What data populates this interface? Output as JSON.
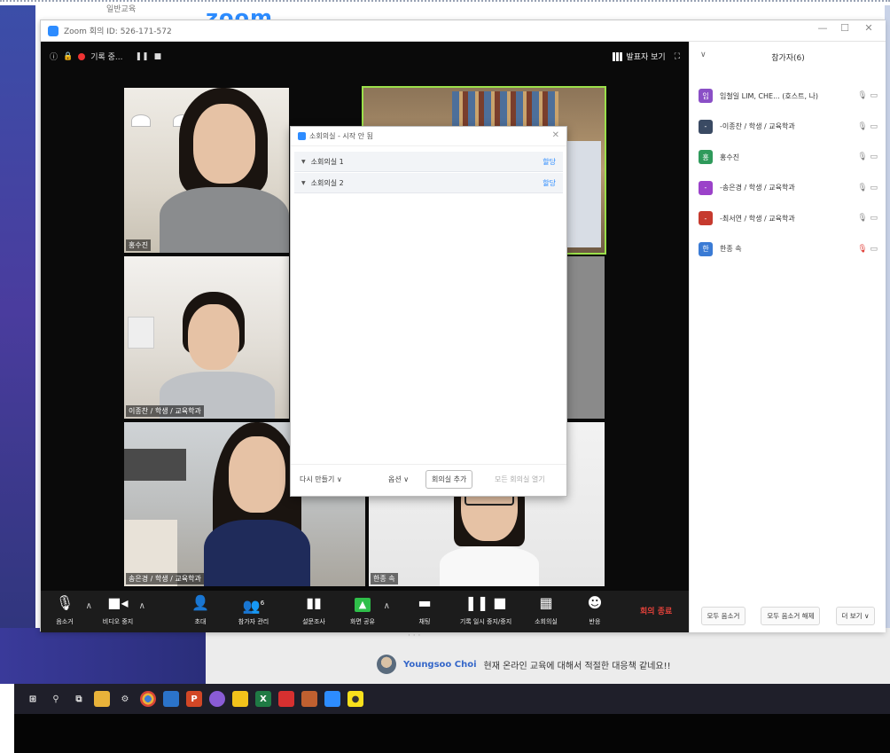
{
  "background": {
    "zoom_logo": "zoom",
    "title_left": "일반교육",
    "chat": {
      "name": "Youngsoo Choi",
      "message": "현재 온라인 교육에 대해서 적절한 대응책 같네요!!"
    }
  },
  "window": {
    "title": "Zoom 회의 ID: 526-171-572",
    "min": "—",
    "max": "☐",
    "close": "✕"
  },
  "video_top": {
    "status": "기록 중...",
    "gallery_view": "발표자 보기",
    "fullscreen": "⛶"
  },
  "tiles": [
    {
      "label": "홍수진"
    },
    {
      "label": ""
    },
    {
      "label": "이종찬 / 학생 / 교육학과"
    },
    {
      "label": ""
    },
    {
      "label": "송은경 / 학생 / 교육학과"
    },
    {
      "label": "한종 속"
    }
  ],
  "toolbar": {
    "mute": "음소거",
    "video": "비디오 중지",
    "invite": "초대",
    "participants": "참가자 관리",
    "participants_count": "6",
    "polls": "설문조사",
    "share": "화면 공유",
    "chat": "채팅",
    "record": "기록 일시 중지/중지",
    "breakout": "소회의실",
    "reactions": "반응",
    "end": "회의 종료"
  },
  "panel": {
    "title": "참가자(6)",
    "participants": [
      {
        "initial": "임",
        "name": "임철일 LIM, CHE... (호스트, 나)",
        "color": "#8a4fc6"
      },
      {
        "initial": "-",
        "name": "-이종찬 / 학생 / 교육학과",
        "color": "#3a4a63"
      },
      {
        "initial": "홍",
        "name": "홍수진",
        "color": "#2f9a5b"
      },
      {
        "initial": "-",
        "name": "-송은경 / 학생 / 교육학과",
        "color": "#9b42c9"
      },
      {
        "initial": "-",
        "name": "-최서연 / 학생 / 교육학과",
        "color": "#c63a2e"
      },
      {
        "initial": "한",
        "name": "한종 속",
        "color": "#3a7bd5"
      }
    ],
    "mute_all": "모두 음소거",
    "unmute_all": "모두 음소거 해제",
    "more": "더 보기 ∨"
  },
  "dialog": {
    "title": "소회의실 - 시작 안 됨",
    "rooms": [
      {
        "name": "소회의실 1",
        "assign": "할당"
      },
      {
        "name": "소회의실 2",
        "assign": "할당"
      }
    ],
    "recreate": "다시 만들기 ∨",
    "options": "옵션 ∨",
    "add_room": "회의실 추가",
    "open_all": "모든 회의실 열기"
  }
}
